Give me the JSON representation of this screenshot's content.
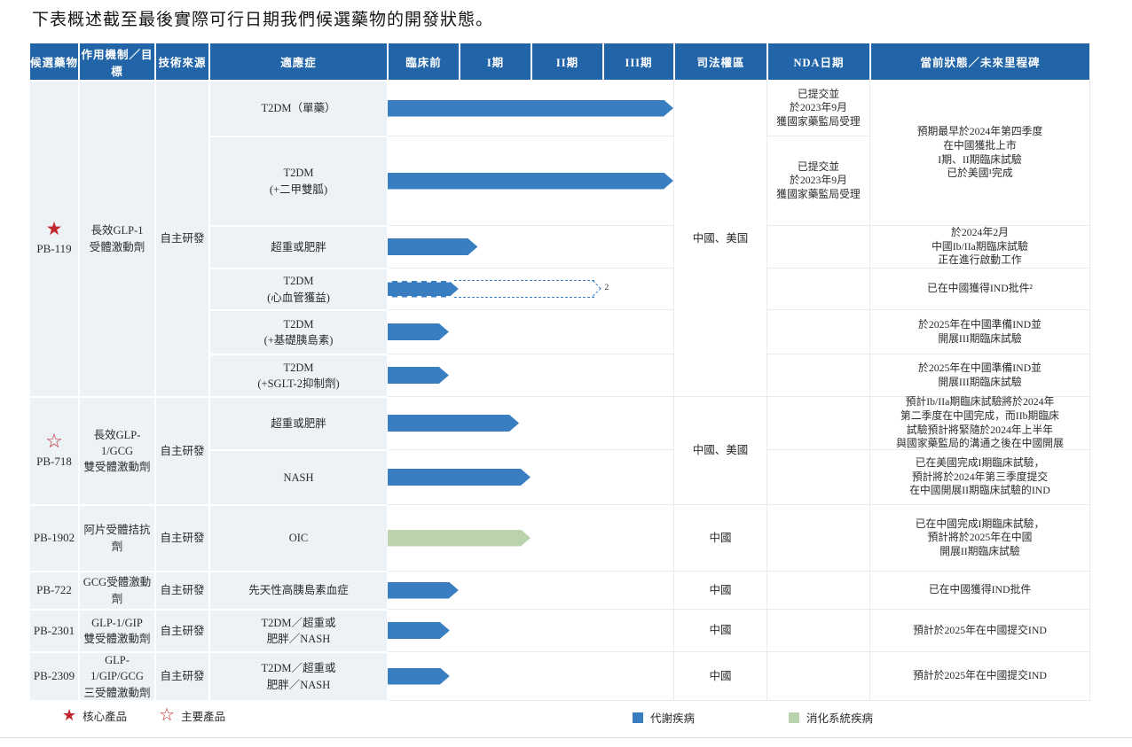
{
  "title": "下表概述截至最後實際可行日期我們候選藥物的開發狀態。",
  "columns": [
    "候選藥物",
    "作用機制／目標",
    "技術來源",
    "適應症",
    "臨床前",
    "I期",
    "II期",
    "III期",
    "司法權區",
    "NDA日期",
    "當前狀態／未來里程碑"
  ],
  "icons": {
    "core_star": "★",
    "major_star": "☆"
  },
  "colors": {
    "header_bg": "#2164A8",
    "left_cell_bg": "#EDF2F7",
    "metabolic": "#3A7EC2",
    "digestive": "#BAD3AD",
    "star_red": "#C1272D",
    "grid_line": "#E7EBEF"
  },
  "phases": [
    "臨床前",
    "I期",
    "II期",
    "III期"
  ],
  "groups": [
    {
      "drug": "PB-119",
      "star": "filled",
      "mechanism": "長效GLP-1\n受體激動劑",
      "source": "自主研發",
      "jurisdiction": "中國、美国",
      "status_top": "預期最早於2024年第四季度\n在中國獲批上市\nI期、II期臨床試驗\n已於美國¹完成",
      "rows": [
        {
          "indication": "T2DM（單藥）",
          "bar": {
            "solid": 100,
            "disease": "metabolic"
          },
          "nda": "已提交並\n於2023年9月\n獲國家藥監局受理",
          "status": ""
        },
        {
          "indication": "T2DM\n(+二甲雙胍)",
          "bar": {
            "solid": 100,
            "disease": "metabolic"
          },
          "nda": "已提交並\n於2023年9月\n獲國家藥監局受理",
          "status": ""
        },
        {
          "indication": "超重或肥胖",
          "bar": {
            "solid": 31.5,
            "disease": "metabolic"
          },
          "nda": "",
          "status": "於2024年2月\n中國Ib/IIa期臨床試驗\n正在進行啟動工作"
        },
        {
          "indication": "T2DM\n(心血管獲益)",
          "bar": {
            "solid": 24.8,
            "dashed": 72.5,
            "note": "2",
            "disease": "metabolic"
          },
          "nda": "",
          "status": "已在中國獲得IND批件²"
        },
        {
          "indication": "T2DM\n(+基礎胰島素)",
          "bar": {
            "solid": 21.4,
            "disease": "metabolic"
          },
          "nda": "",
          "status": "於2025年在中國準備IND並\n開展III期臨床試驗"
        },
        {
          "indication": "T2DM\n(+SGLT-2抑制劑)",
          "bar": {
            "solid": 21.4,
            "disease": "metabolic"
          },
          "nda": "",
          "status": "於2025年在中國準備IND並\n開展III期臨床試驗"
        }
      ]
    },
    {
      "drug": "PB-718",
      "star": "outline",
      "mechanism": "長效GLP-1/GCG\n雙受體激動劑",
      "source": "自主研發",
      "jurisdiction": "中國、美國",
      "rows": [
        {
          "indication": "超重或肥胖",
          "bar": {
            "solid": 46,
            "disease": "metabolic"
          },
          "nda": "",
          "status": "預計Ib/IIa期臨床試驗將於2024年\n第二季度在中國完成，而IIb期臨床\n試驗預計將緊隨於2024年上半年\n與國家藥監局的溝通之後在中國開展"
        },
        {
          "indication": "NASH",
          "bar": {
            "solid": 50,
            "disease": "metabolic"
          },
          "nda": "",
          "status": "已在美國完成I期臨床試驗，\n預計將於2024年第三季度提交\n在中國開展II期臨床試驗的IND"
        }
      ]
    },
    {
      "drug": "PB-1902",
      "star": "none",
      "mechanism": "阿片受體拮抗劑",
      "source": "自主研發",
      "jurisdiction": "中國",
      "rows": [
        {
          "indication": "OIC",
          "bar": {
            "solid": 50,
            "disease": "digestive"
          },
          "nda": "",
          "status": "已在中國完成I期臨床試驗，\n預計將於2025年在中國\n開展II期臨床試驗"
        }
      ]
    },
    {
      "drug": "PB-722",
      "star": "none",
      "mechanism": "GCG受體激動劑",
      "source": "自主研發",
      "jurisdiction": "中國",
      "rows": [
        {
          "indication": "先天性高胰島素血症",
          "bar": {
            "solid": 24.8,
            "disease": "metabolic"
          },
          "nda": "",
          "status": "已在中國獲得IND批件"
        }
      ]
    },
    {
      "drug": "PB-2301",
      "star": "none",
      "mechanism": "GLP-1/GIP\n雙受體激動劑",
      "source": "自主研發",
      "jurisdiction": "中國",
      "rows": [
        {
          "indication": "T2DM／超重或\n肥胖／NASH",
          "bar": {
            "solid": 21.7,
            "disease": "metabolic"
          },
          "nda": "",
          "status": "預計於2025年在中國提交IND"
        }
      ]
    },
    {
      "drug": "PB-2309",
      "star": "none",
      "mechanism": "GLP-1/GIP/GCG\n三受體激動劑",
      "source": "自主研發",
      "jurisdiction": "中國",
      "rows": [
        {
          "indication": "T2DM／超重或\n肥胖／NASH",
          "bar": {
            "solid": 21.7,
            "disease": "metabolic"
          },
          "nda": "",
          "status": "預計於2025年在中國提交IND"
        }
      ]
    }
  ],
  "legend": {
    "core": "核心產品",
    "major": "主要產品",
    "metabolic": "代謝疾病",
    "digestive": "消化系統疾病"
  }
}
